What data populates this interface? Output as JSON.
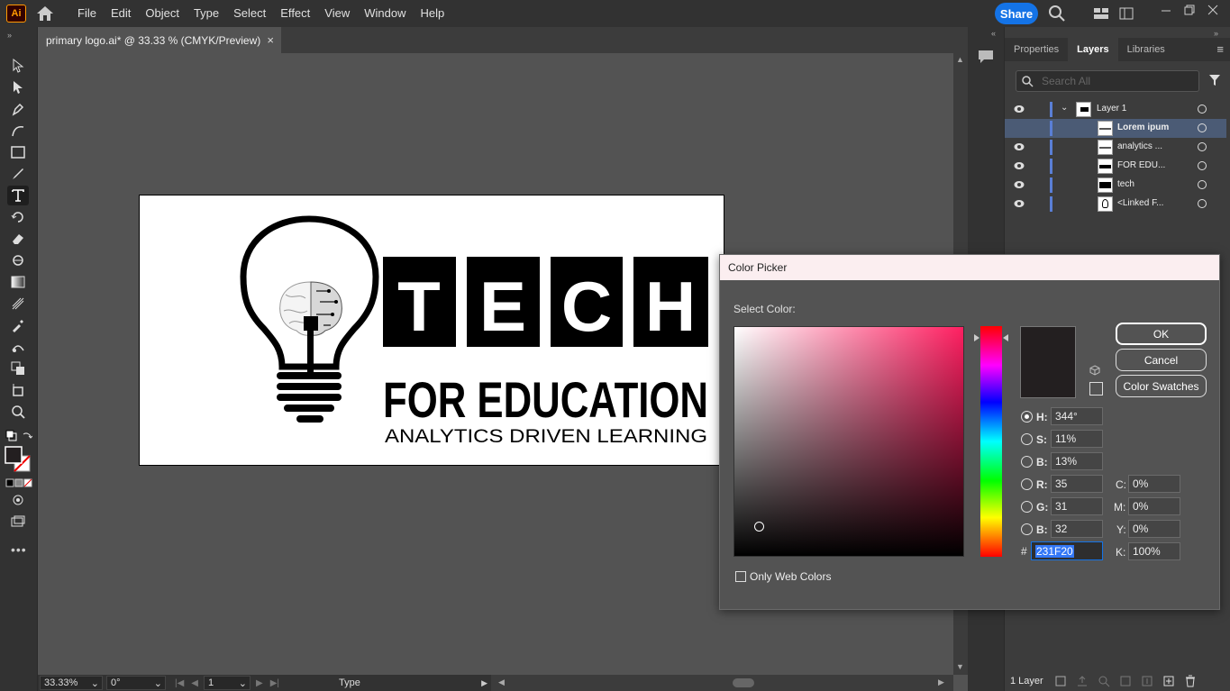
{
  "app": {
    "logo_text": "Ai"
  },
  "menu": [
    "File",
    "Edit",
    "Object",
    "Type",
    "Select",
    "Effect",
    "View",
    "Window",
    "Help"
  ],
  "share_label": "Share",
  "doc_tab": {
    "title": "primary logo.ai* @ 33.33 % (CMYK/Preview)",
    "close": "×"
  },
  "artwork": {
    "letters": [
      "T",
      "E",
      "C",
      "H"
    ],
    "line1": "FOR EDUCATION",
    "line2": "ANALYTICS DRIVEN LEARNING"
  },
  "statusbar": {
    "zoom": "33.33%",
    "rotation": "0°",
    "artboard": "1",
    "tool": "Type"
  },
  "panel": {
    "tabs": [
      "Properties",
      "Layers",
      "Libraries"
    ],
    "search_placeholder": "Search All",
    "layers": [
      {
        "name": "Layer 1"
      },
      {
        "name": "Lorem ipum"
      },
      {
        "name": "analytics ..."
      },
      {
        "name": "FOR EDU..."
      },
      {
        "name": "tech"
      },
      {
        "name": "<Linked F..."
      }
    ],
    "footer_count": "1 Layer"
  },
  "color_picker": {
    "title": "Color Picker",
    "select_label": "Select Color:",
    "current_color": "#231f20",
    "buttons": {
      "ok": "OK",
      "cancel": "Cancel",
      "swatches": "Color Swatches"
    },
    "fields": {
      "H": {
        "label": "H:",
        "value": "344°"
      },
      "S": {
        "label": "S:",
        "value": "11%"
      },
      "B": {
        "label": "B:",
        "value": "13%"
      },
      "R": {
        "label": "R:",
        "value": "35"
      },
      "G": {
        "label": "G:",
        "value": "31"
      },
      "Bl": {
        "label": "B:",
        "value": "32"
      },
      "C": {
        "label": "C:",
        "value": "0%"
      },
      "M": {
        "label": "M:",
        "value": "0%"
      },
      "Y": {
        "label": "Y:",
        "value": "0%"
      },
      "K": {
        "label": "K:",
        "value": "100%"
      }
    },
    "hex_prefix": "#",
    "hex": "231F20",
    "web_colors_label": "Only Web Colors"
  }
}
